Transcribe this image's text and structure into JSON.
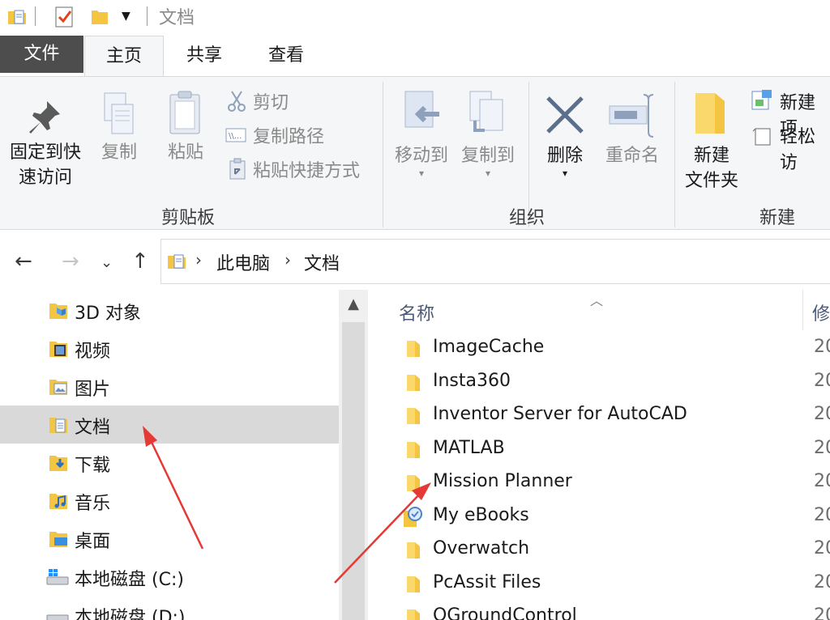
{
  "window": {
    "title": "文档"
  },
  "tabs": [
    {
      "label": "文件"
    },
    {
      "label": "主页"
    },
    {
      "label": "共享"
    },
    {
      "label": "查看"
    }
  ],
  "ribbon": {
    "clipboard": {
      "pin_line1": "固定到快",
      "pin_line2": "速访问",
      "copy": "复制",
      "paste": "粘贴",
      "cut": "剪切",
      "copy_path": "复制路径",
      "paste_shortcut": "粘贴快捷方式",
      "group": "剪贴板"
    },
    "organize": {
      "move_to": "移动到",
      "copy_to": "复制到",
      "delete": "删除",
      "rename": "重命名",
      "group": "组织"
    },
    "new": {
      "folder_line1": "新建",
      "folder_line2": "文件夹",
      "new_item": "新建项",
      "easy_access": "轻松访",
      "group": "新建"
    }
  },
  "address": {
    "crumbs": [
      "此电脑",
      "文档"
    ]
  },
  "nav": {
    "items": [
      {
        "label": "3D 对象",
        "icon": "3d-objects-icon"
      },
      {
        "label": "视频",
        "icon": "videos-icon"
      },
      {
        "label": "图片",
        "icon": "pictures-icon"
      },
      {
        "label": "文档",
        "icon": "documents-icon",
        "selected": true
      },
      {
        "label": "下载",
        "icon": "downloads-icon"
      },
      {
        "label": "音乐",
        "icon": "music-icon"
      },
      {
        "label": "桌面",
        "icon": "desktop-icon"
      },
      {
        "label": "本地磁盘 (C:)",
        "icon": "drive-c-icon"
      },
      {
        "label": "本地磁盘 (D:)",
        "icon": "drive-d-icon"
      }
    ]
  },
  "files": {
    "col_name": "名称",
    "col_modified": "修",
    "rows": [
      {
        "name": "ImageCache",
        "date": "20",
        "icon": "folder-icon"
      },
      {
        "name": "Insta360",
        "date": "20",
        "icon": "folder-icon"
      },
      {
        "name": "Inventor Server for AutoCAD",
        "date": "20",
        "icon": "folder-icon"
      },
      {
        "name": "MATLAB",
        "date": "20",
        "icon": "folder-icon"
      },
      {
        "name": "Mission Planner",
        "date": "20",
        "icon": "folder-icon"
      },
      {
        "name": "My eBooks",
        "date": "20",
        "icon": "ebooks-folder-icon"
      },
      {
        "name": "Overwatch",
        "date": "20",
        "icon": "folder-icon"
      },
      {
        "name": "PcAssit Files",
        "date": "20",
        "icon": "folder-icon"
      },
      {
        "name": "QGroundControl",
        "date": "20",
        "icon": "folder-icon"
      }
    ]
  },
  "colors": {
    "file_tab": "#4d4d4d",
    "selection": "#d9d9d9",
    "folder": "#f4c542",
    "annotation_arrow": "#e53935"
  }
}
